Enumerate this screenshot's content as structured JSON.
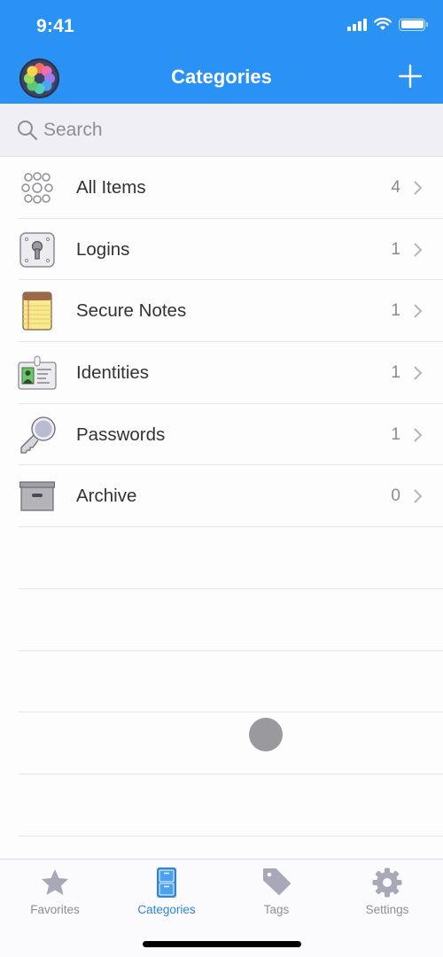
{
  "status_bar": {
    "time": "9:41"
  },
  "header": {
    "title": "Categories",
    "logo_icon": "app-logo-icon",
    "add_icon": "plus-icon"
  },
  "search": {
    "placeholder": "Search",
    "value": ""
  },
  "categories": [
    {
      "label": "All Items",
      "count": "4",
      "icon": "all-items-icon"
    },
    {
      "label": "Logins",
      "count": "1",
      "icon": "login-keyhole-icon"
    },
    {
      "label": "Secure Notes",
      "count": "1",
      "icon": "notepad-icon"
    },
    {
      "label": "Identities",
      "count": "1",
      "icon": "id-badge-icon"
    },
    {
      "label": "Passwords",
      "count": "1",
      "icon": "key-icon"
    },
    {
      "label": "Archive",
      "count": "0",
      "icon": "archive-box-icon"
    }
  ],
  "tab_bar": {
    "tabs": [
      {
        "label": "Favorites",
        "icon": "star-icon",
        "active": false
      },
      {
        "label": "Categories",
        "icon": "cabinet-icon",
        "active": true
      },
      {
        "label": "Tags",
        "icon": "tag-icon",
        "active": false
      },
      {
        "label": "Settings",
        "icon": "gear-icon",
        "active": false
      }
    ]
  },
  "colors": {
    "accent": "#2a91f5",
    "active_tab": "#2a85e0",
    "inactive_tab": "#8e8e96"
  }
}
